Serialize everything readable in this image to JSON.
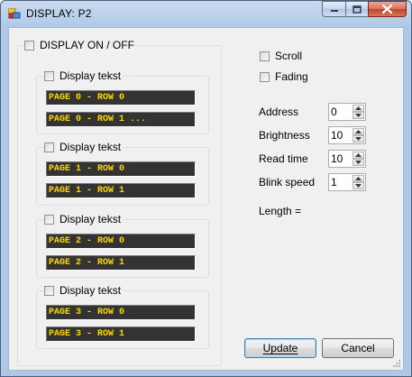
{
  "window": {
    "title": "DISPLAY: P2"
  },
  "main_group": {
    "checkbox_label": "DISPLAY ON / OFF"
  },
  "pages": [
    {
      "checkbox_label": "Display tekst",
      "row0": "PAGE 0 - ROW 0",
      "row1": "PAGE 0 - ROW 1 ..."
    },
    {
      "checkbox_label": "Display tekst",
      "row0": "PAGE 1 - ROW 0",
      "row1": "PAGE 1 - ROW 1"
    },
    {
      "checkbox_label": "Display tekst",
      "row0": "PAGE 2 - ROW 0",
      "row1": "PAGE 2 - ROW 1"
    },
    {
      "checkbox_label": "Display tekst",
      "row0": "PAGE 3 - ROW 0",
      "row1": "PAGE 3 - ROW 1"
    }
  ],
  "options": {
    "scroll_label": "Scroll",
    "fading_label": "Fading"
  },
  "settings": {
    "address_label": "Address",
    "address_value": "0",
    "brightness_label": "Brightness",
    "brightness_value": "10",
    "readtime_label": "Read time",
    "readtime_value": "10",
    "blinkspeed_label": "Blink speed",
    "blinkspeed_value": "1",
    "length_label": "Length ="
  },
  "buttons": {
    "update_label": "Update",
    "cancel_label": "Cancel"
  },
  "colors": {
    "lcd_background": "#333333",
    "lcd_text": "#ffd800",
    "close_button": "#c0452a"
  }
}
